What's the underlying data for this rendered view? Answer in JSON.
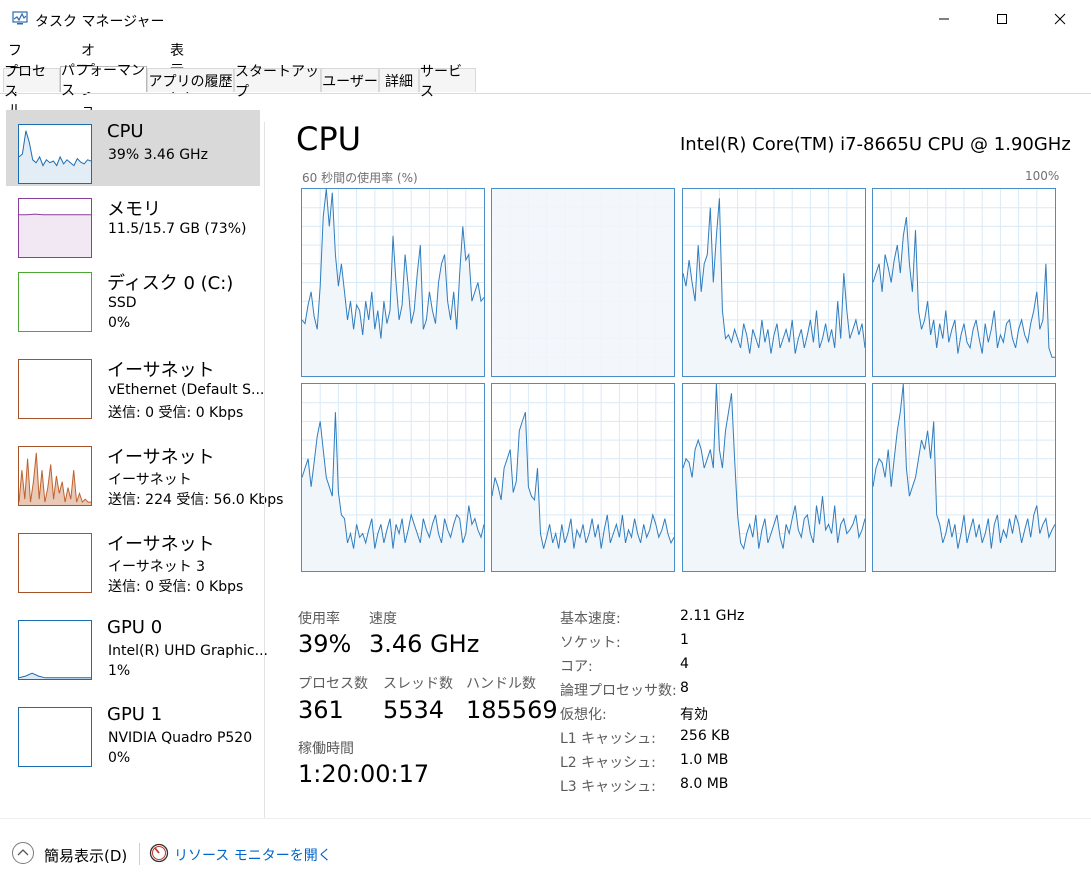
{
  "window": {
    "title": "タスク マネージャー",
    "controls": [
      "minimize",
      "maximize",
      "close"
    ]
  },
  "menu": [
    "ファイル(F)",
    "オプション(O)",
    "表示(V)"
  ],
  "tabs": [
    {
      "label": "プロセス",
      "active": false
    },
    {
      "label": "パフォーマンス",
      "active": true
    },
    {
      "label": "アプリの履歴",
      "active": false
    },
    {
      "label": "スタートアップ",
      "active": false
    },
    {
      "label": "ユーザー",
      "active": false
    },
    {
      "label": "詳細",
      "active": false
    },
    {
      "label": "サービス",
      "active": false
    }
  ],
  "sidebar": [
    {
      "title": "CPU",
      "line1": "39% 3.46 GHz",
      "line2": "",
      "selected": true,
      "color": "#1b6db3"
    },
    {
      "title": "メモリ",
      "line1": "11.5/15.7 GB (73%)",
      "line2": "",
      "selected": false,
      "color": "#8b3f9c"
    },
    {
      "title": "ディスク 0 (C:)",
      "line1": "SSD",
      "line2": "0%",
      "selected": false,
      "color": "#4da833"
    },
    {
      "title": "イーサネット",
      "line1": "vEthernet (Default S...",
      "line2": "送信: 0 受信: 0 Kbps",
      "selected": false,
      "color": "#a7532a"
    },
    {
      "title": "イーサネット",
      "line1": "イーサネット",
      "line2": "送信: 224 受信: 56.0 Kbps",
      "selected": false,
      "color": "#a7532a"
    },
    {
      "title": "イーサネット",
      "line1": "イーサネット 3",
      "line2": "送信: 0 受信: 0 Kbps",
      "selected": false,
      "color": "#a7532a"
    },
    {
      "title": "GPU 0",
      "line1": "Intel(R) UHD Graphic...",
      "line2": "1%",
      "selected": false,
      "color": "#1b6db3"
    },
    {
      "title": "GPU 1",
      "line1": "NVIDIA Quadro P520",
      "line2": "0%",
      "selected": false,
      "color": "#1b6db3"
    }
  ],
  "main": {
    "title": "CPU",
    "model": "Intel(R) Core(TM) i7-8665U CPU @ 1.90GHz",
    "graph_label_left": "60 秒間の使用率 (%)",
    "graph_label_right": "100%",
    "stats": {
      "usage_label": "使用率",
      "usage": "39%",
      "speed_label": "速度",
      "speed": "3.46 GHz",
      "processes_label": "プロセス数",
      "processes": "361",
      "threads_label": "スレッド数",
      "threads": "5534",
      "handles_label": "ハンドル数",
      "handles": "185569",
      "uptime_label": "稼働時間",
      "uptime": "1:20:00:17"
    },
    "details": [
      {
        "k": "基本速度:",
        "v": "2.11 GHz"
      },
      {
        "k": "ソケット:",
        "v": "1"
      },
      {
        "k": "コア:",
        "v": "4"
      },
      {
        "k": "論理プロセッサ数:",
        "v": "8"
      },
      {
        "k": "仮想化:",
        "v": "有効"
      },
      {
        "k": "L1 キャッシュ:",
        "v": "256 KB"
      },
      {
        "k": "L2 キャッシュ:",
        "v": "1.0 MB"
      },
      {
        "k": "L3 キャッシュ:",
        "v": "8.0 MB"
      }
    ]
  },
  "cpu_graphs": [
    [
      30,
      28,
      38,
      45,
      32,
      25,
      48,
      85,
      100,
      80,
      98,
      65,
      48,
      60,
      45,
      30,
      40,
      25,
      38,
      35,
      22,
      40,
      30,
      45,
      25,
      35,
      20,
      40,
      28,
      35,
      75,
      50,
      30,
      38,
      65,
      48,
      28,
      35,
      55,
      70,
      25,
      30,
      45,
      35,
      28,
      50,
      60,
      65,
      40,
      30,
      45,
      25,
      55,
      80,
      62,
      65,
      40,
      45,
      50,
      40,
      42
    ],
    [
      0,
      0,
      0,
      0,
      0,
      0,
      0,
      0,
      0,
      0,
      0,
      0,
      0,
      0,
      0,
      0,
      0,
      0,
      0,
      0,
      0,
      0,
      0,
      0,
      0,
      0,
      0,
      0,
      0,
      0,
      0,
      0,
      0,
      0,
      0,
      0,
      0,
      0,
      0,
      0,
      0,
      0,
      0,
      0,
      0,
      0,
      0,
      0,
      0,
      0,
      0,
      0,
      0,
      0,
      0,
      0,
      0,
      0,
      0,
      0,
      0
    ],
    [
      55,
      48,
      62,
      50,
      40,
      70,
      45,
      60,
      65,
      90,
      50,
      75,
      95,
      35,
      20,
      22,
      18,
      25,
      20,
      15,
      28,
      22,
      12,
      25,
      20,
      15,
      30,
      18,
      25,
      12,
      22,
      28,
      15,
      20,
      25,
      18,
      30,
      12,
      20,
      25,
      15,
      22,
      30,
      18,
      35,
      15,
      20,
      28,
      18,
      25,
      15,
      40,
      20,
      55,
      35,
      20,
      25,
      30,
      22,
      28,
      15
    ],
    [
      50,
      55,
      60,
      45,
      65,
      58,
      50,
      62,
      70,
      55,
      75,
      85,
      60,
      45,
      78,
      35,
      25,
      30,
      40,
      22,
      30,
      15,
      28,
      20,
      35,
      18,
      25,
      30,
      12,
      22,
      28,
      18,
      15,
      25,
      30,
      20,
      12,
      28,
      18,
      25,
      35,
      15,
      22,
      18,
      28,
      30,
      20,
      15,
      25,
      30,
      22,
      18,
      28,
      35,
      45,
      25,
      30,
      60,
      15,
      10,
      10
    ],
    [
      50,
      55,
      60,
      45,
      58,
      72,
      80,
      65,
      50,
      45,
      40,
      85,
      42,
      30,
      28,
      15,
      20,
      12,
      25,
      18,
      20,
      15,
      22,
      28,
      12,
      20,
      25,
      15,
      22,
      28,
      12,
      25,
      20,
      28,
      15,
      22,
      30,
      25,
      20,
      15,
      28,
      22,
      18,
      25,
      30,
      20,
      15,
      28,
      22,
      18,
      25,
      30,
      28,
      15,
      20,
      35,
      25,
      28,
      22,
      18,
      25
    ],
    [
      40,
      50,
      45,
      38,
      55,
      60,
      65,
      42,
      48,
      75,
      80,
      85,
      45,
      40,
      38,
      55,
      20,
      12,
      18,
      25,
      15,
      20,
      12,
      25,
      15,
      20,
      28,
      12,
      22,
      18,
      25,
      15,
      20,
      28,
      18,
      25,
      12,
      22,
      30,
      15,
      20,
      25,
      18,
      30,
      15,
      22,
      18,
      28,
      20,
      15,
      25,
      18,
      22,
      30,
      25,
      18,
      22,
      28,
      20,
      15,
      18
    ],
    [
      55,
      60,
      58,
      50,
      65,
      70,
      65,
      55,
      60,
      65,
      55,
      100,
      65,
      55,
      75,
      85,
      95,
      60,
      30,
      15,
      12,
      20,
      25,
      18,
      30,
      12,
      22,
      28,
      15,
      20,
      25,
      30,
      18,
      12,
      25,
      20,
      28,
      35,
      22,
      18,
      28,
      30,
      20,
      15,
      35,
      25,
      40,
      22,
      25,
      20,
      35,
      15,
      25,
      28,
      20,
      22,
      25,
      30,
      18,
      22,
      28
    ],
    [
      45,
      55,
      60,
      58,
      50,
      65,
      45,
      60,
      75,
      85,
      100,
      55,
      40,
      45,
      50,
      60,
      70,
      65,
      75,
      60,
      80,
      30,
      25,
      15,
      20,
      28,
      18,
      25,
      12,
      20,
      30,
      15,
      22,
      28,
      18,
      25,
      15,
      20,
      28,
      12,
      25,
      30,
      15,
      22,
      18,
      28,
      20,
      30,
      25,
      15,
      22,
      28,
      18,
      30,
      35,
      20,
      25,
      28,
      18,
      22,
      25
    ]
  ],
  "bottom": {
    "fewer_details": "簡易表示(D)",
    "resource_monitor": "リソース モニターを開く"
  }
}
